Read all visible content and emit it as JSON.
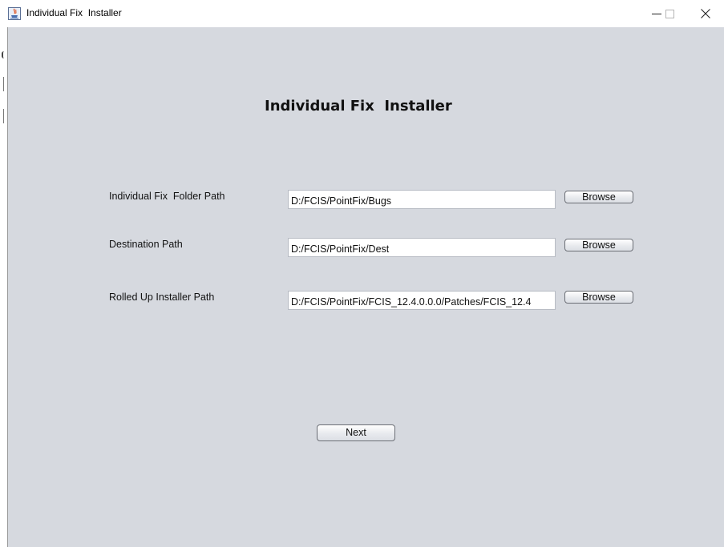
{
  "window": {
    "title": "Individual Fix  Installer",
    "controls": {
      "minimize": "minimize-icon",
      "maximize": "maximize-icon",
      "close": "close-icon"
    }
  },
  "main": {
    "heading": "Individual Fix  Installer",
    "rows": [
      {
        "label": "Individual Fix  Folder Path",
        "value": "D:/FCIS/PointFix/Bugs",
        "button": "Browse"
      },
      {
        "label": "Destination Path",
        "value": "D:/FCIS/PointFix/Dest",
        "button": "Browse"
      },
      {
        "label": "Rolled Up Installer Path",
        "value": "D:/FCIS/PointFix/FCIS_12.4.0.0.0/Patches/FCIS_12.4",
        "button": "Browse"
      }
    ],
    "next_label": "Next"
  },
  "colors": {
    "content_background": "#d6d9df",
    "titlebar_background": "#ffffff"
  }
}
